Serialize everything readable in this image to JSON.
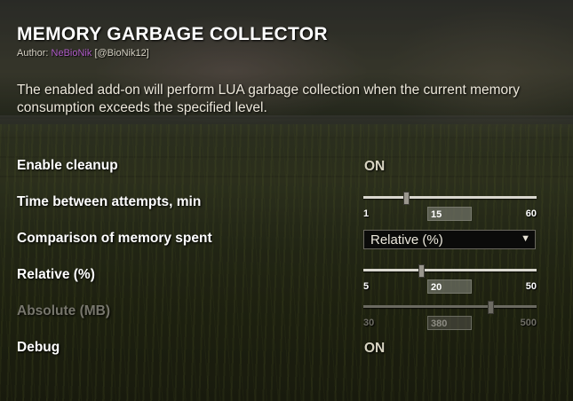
{
  "header": {
    "title": "MEMORY GARBAGE COLLECTOR",
    "author_prefix": "Author:",
    "author_name": "NeBioNik",
    "author_handle": "[@BioNik12]"
  },
  "description": "The enabled add-on will perform LUA garbage collection when the current memory consumption exceeds the specified level.",
  "settings": {
    "enable_cleanup": {
      "label": "Enable cleanup",
      "value": "ON"
    },
    "time_between": {
      "label": "Time between attempts, min",
      "min": "1",
      "max": "60",
      "value": "15",
      "fraction": 0.24
    },
    "comparison": {
      "label": "Comparison of memory spent",
      "selected": "Relative (%)"
    },
    "relative": {
      "label": "Relative (%)",
      "min": "5",
      "max": "50",
      "value": "20",
      "fraction": 0.33
    },
    "absolute": {
      "label": "Absolute (MB)",
      "min": "30",
      "max": "500",
      "value": "380",
      "fraction": 0.74,
      "disabled": true
    },
    "debug": {
      "label": "Debug",
      "value": "ON"
    }
  },
  "icons": {
    "dropdown_arrow": "triangle-down-icon"
  },
  "colors": {
    "author_name": "#b05cc8",
    "label": "#ffffff",
    "disabled": "#77766c",
    "toggle_on": "#d8d4c2"
  }
}
